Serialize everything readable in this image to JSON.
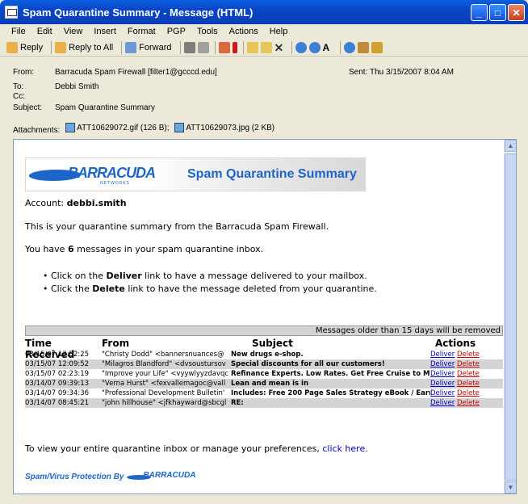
{
  "window": {
    "title": "Spam Quarantine Summary - Message (HTML)"
  },
  "menu": [
    "File",
    "Edit",
    "View",
    "Insert",
    "Format",
    "PGP",
    "Tools",
    "Actions",
    "Help"
  ],
  "toolbar": {
    "reply": "Reply",
    "reply_all": "Reply to All",
    "forward": "Forward"
  },
  "header": {
    "from_label": "From:",
    "from": "Barracuda Spam Firewall [filter1@gcccd.edu]",
    "sent_label": "Sent:",
    "sent": "Thu 3/15/2007 8:04 AM",
    "to_label": "To:",
    "to": "Debbi Smith",
    "cc_label": "Cc:",
    "cc": "",
    "subject_label": "Subject:",
    "subject": "Spam Quarantine Summary",
    "attachments_label": "Attachments:",
    "attachments": [
      "ATT10629072.gif (126 B);",
      "ATT10629073.jpg (2 KB)"
    ]
  },
  "email": {
    "logo_text": "BARRACUDA",
    "logo_sub": "NETWORKS",
    "banner_title": "Spam Quarantine Summary",
    "account_label": "Account:",
    "account": "debbi.smith",
    "intro": "This is your quarantine summary from the Barracuda Spam Firewall.",
    "count_pre": "You have",
    "count": "6",
    "count_post": "messages in your spam quarantine inbox.",
    "bullet1_pre": "Click on the",
    "bullet1_word": "Deliver",
    "bullet1_post": "link to have a message delivered to your mailbox.",
    "bullet2_pre": "Click the",
    "bullet2_word": "Delete",
    "bullet2_post": "link to have the message deleted from your quarantine.",
    "older_notice": "Messages older than 15 days will be removed",
    "columns": [
      "Time Received",
      "From",
      "Subject",
      "Actions"
    ],
    "rows": [
      {
        "time": "03/15/07 13:52:25",
        "from": "\"Christy Dodd\" <bannersnuances@",
        "subject": "New drugs e-shop."
      },
      {
        "time": "03/15/07 12:09:52",
        "from": "\"Milagros Blandford\" <dvsoustursov",
        "subject": "Special discounts for all our customers!"
      },
      {
        "time": "03/15/07 02:23:19",
        "from": "\"Improve your Life\" <vyywlyyzdavqc",
        "subject": "Refinance Experts. Low Rates. Get Free Cruise to Mexic"
      },
      {
        "time": "03/14/07 09:39:13",
        "from": "\"Verna Hurst\" <fexvallemagoc@vall",
        "subject": "Lean and mean is in"
      },
      {
        "time": "03/14/07 09:34:36",
        "from": "\"Professional Development Bulletin'",
        "subject": "Includes: Free 200 Page Sales Strategy eBook / Earn Yo"
      },
      {
        "time": "03/14/07 08:45:21",
        "from": "\"john hillhouse\" <jfkhayward@sbcgl",
        "subject": "RE:"
      }
    ],
    "deliver": "Deliver",
    "delete": "Delete",
    "footer_pre": "To view your entire quarantine inbox or manage your preferences,",
    "footer_link": "click here.",
    "protection": "Spam/Virus Protection By",
    "protection_logo": "BARRACUDA"
  }
}
